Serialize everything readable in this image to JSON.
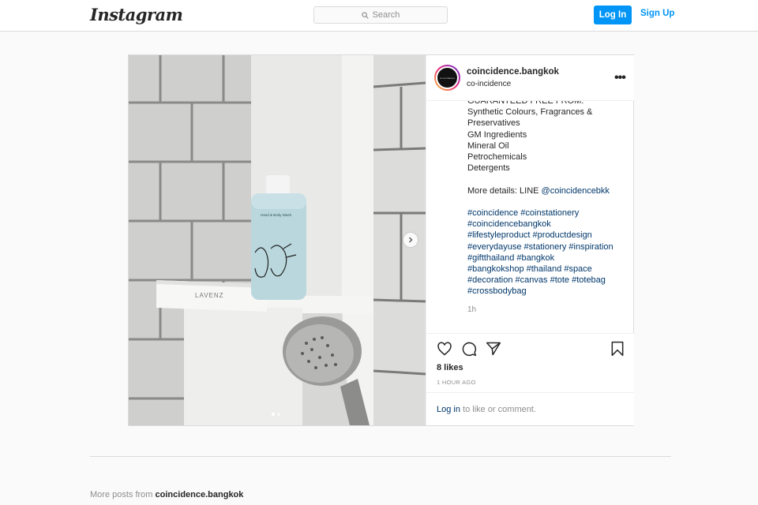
{
  "header": {
    "logo": "Instagram",
    "search_placeholder": "Search",
    "login_label": "Log In",
    "signup_label": "Sign Up"
  },
  "post": {
    "username": "coincidence.bangkok",
    "location": "co-incidence",
    "avatar_text": "co-incidence",
    "photo_label": "LAVENZ",
    "bottle_label": "Hand & Body Wash",
    "caption_lines": [
      "GUARANTEED FREE FROM:",
      "Synthetic Colours, Fragrances &",
      "Preservatives",
      "GM Ingredients",
      "Mineral Oil",
      "Petrochemicals",
      "Detergents"
    ],
    "details_prefix": "More details: LINE ",
    "details_handle": "@coincidencebkk",
    "hashtag_lines": [
      "#coincidence #coinstationery",
      "#coincidencebangkok",
      "#lifestyleproduct #productdesign",
      "#everydayuse #stationery #inspiration",
      "#giftthailand #bangkok",
      "#bangkokshop #thailand #space",
      "#decoration #canvas #tote #totebag",
      "#crossbodybag"
    ],
    "caption_time": "1h",
    "likes": "8 likes",
    "time_ago": "1 HOUR AGO",
    "comment_link": "Log in",
    "comment_text": " to like or comment.",
    "carousel": {
      "total": 2,
      "current": 1
    }
  },
  "more_posts": {
    "prefix": "More posts from ",
    "user": "coincidence.bangkok"
  },
  "colors": {
    "accent": "#0095f6",
    "link": "#00376b",
    "muted": "#8e8e8e",
    "text": "#262626"
  }
}
